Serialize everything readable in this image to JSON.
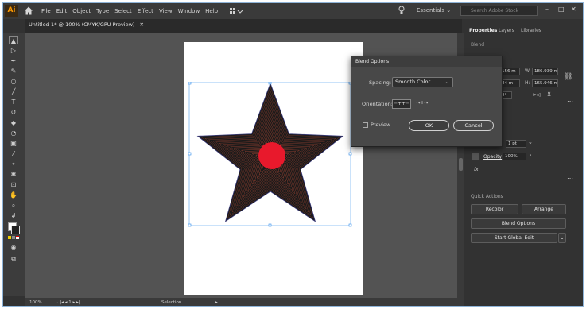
{
  "app": {
    "logo": "Ai"
  },
  "menu": [
    "File",
    "Edit",
    "Object",
    "Type",
    "Select",
    "Effect",
    "View",
    "Window",
    "Help"
  ],
  "workspace": "Essentials",
  "search_placeholder": "Search Adobe Stock",
  "document_tab": "Untitled-1* @ 100% (CMYK/GPU Preview)",
  "panel": {
    "tabs": [
      "Properties",
      "Layers",
      "Libraries"
    ],
    "blend_label": "Blend",
    "x_value": "156 m",
    "y_value": "84 m",
    "w_label": "W:",
    "w_value": "186.939 m",
    "h_label": "H:",
    "h_value": "165.946 m",
    "stroke_value": "1 pt",
    "opacity_label": "Opacity",
    "opacity_value": "100%",
    "fx_label": "fx.",
    "quick_actions": "Quick Actions",
    "recolor": "Recolor",
    "arrange": "Arrange",
    "blend_options": "Blend Options",
    "start_global_edit": "Start Global Edit"
  },
  "dialog": {
    "title": "Blend Options",
    "spacing_label": "Spacing:",
    "spacing_value": "Smooth Color",
    "orientation_label": "Orientation:",
    "preview_label": "Preview",
    "ok": "OK",
    "cancel": "Cancel"
  },
  "status": {
    "zoom": "100%",
    "tool": "Selection"
  },
  "colors": {
    "accent": "#2d8ceb",
    "star_fill": "#1a1a1a",
    "blend_lines": "#c8503a",
    "circle": "#e8192c"
  }
}
